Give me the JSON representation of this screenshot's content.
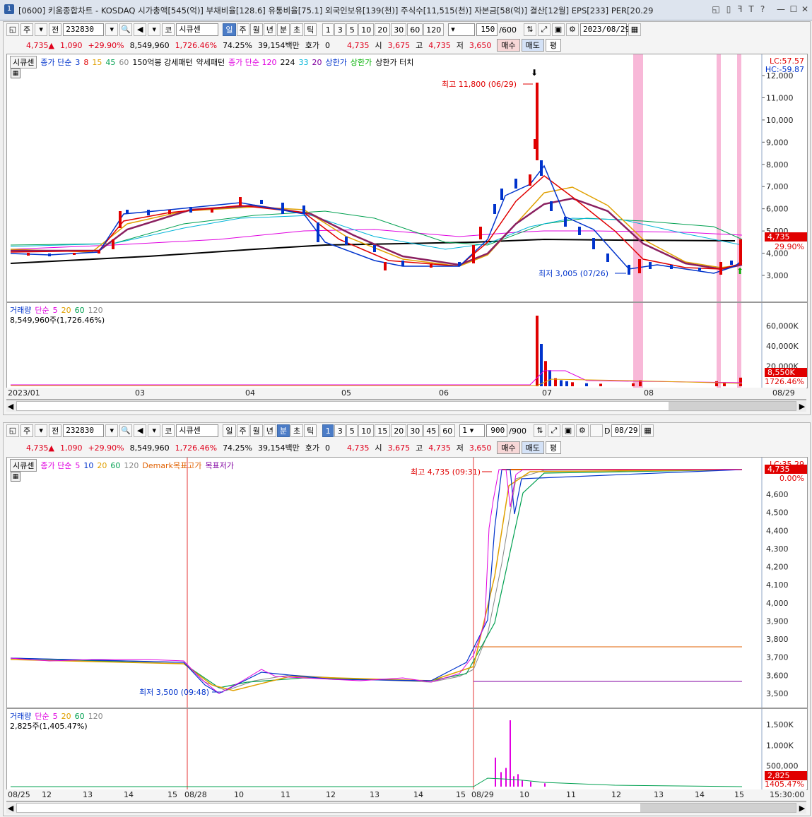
{
  "window": {
    "app_number": "1",
    "title": "[0600] 키움종합차트 - KOSDAQ 시가총액[545(억)] 부채비율[128.6] 유통비율[75.1] 외국인보유[139(천)] 주식수[11,515(천)] 자본금[58(억)] 결산[12월] EPS[233] PER[20.29",
    "controls": [
      "◱",
      "▯",
      "ꟻ",
      "T",
      "?",
      "—",
      "☐",
      "✕"
    ]
  },
  "top": {
    "toolbar": {
      "mode_jusik": "주",
      "mode_jeon": "전",
      "code": "232830",
      "market": "코",
      "name": "시큐센",
      "periods": [
        "일",
        "주",
        "월",
        "년",
        "분",
        "초",
        "틱"
      ],
      "active_period": "일",
      "numbers": [
        "1",
        "3",
        "5",
        "10",
        "20",
        "30",
        "60",
        "120"
      ],
      "count": "150",
      "count_max": "/600",
      "date": "2023/08/29"
    },
    "quote": {
      "price": "4,735",
      "change": "1,090",
      "pct": "+29.90%",
      "volume": "8,549,960",
      "vol_pct": "1,726.46%",
      "turnover": "74.25%",
      "amount": "39,154백만",
      "hoga_label": "호가",
      "hoga": "0",
      "last": "4,735",
      "open_label": "시",
      "open": "3,675",
      "high_label": "고",
      "high": "4,735",
      "low_label": "저",
      "low": "3,650",
      "buy": "매수",
      "sell": "매도",
      "avg": "평"
    },
    "legend": {
      "name": "시큐센",
      "ma_label": "종가 단순",
      "ma": [
        "3",
        "8",
        "15",
        "45",
        "60"
      ],
      "p150": "150억봉 강세패턴",
      "weak": "약세패턴",
      "ma2_label": "종가 단순 120",
      "ma2": [
        "224",
        "33",
        "20"
      ],
      "upper1": "상한가",
      "upper2": "상한가",
      "touch": "상한가 터치"
    },
    "annotations": {
      "high": "최고 11,800 (06/29)",
      "low": "최저 3,005 (07/26)",
      "lc": "LC:57.57",
      "hc": "HC:-59.87",
      "price_tag": "4,735",
      "pct_tag": "29.90%"
    },
    "y_ticks": [
      "12,000",
      "11,000",
      "10,000",
      "9,000",
      "8,000",
      "7,000",
      "6,000",
      "5,000",
      "4,000",
      "3,000"
    ],
    "volume": {
      "label": "거래량",
      "ma_label": "단순",
      "ma": [
        "5",
        "20",
        "60",
        "120"
      ],
      "value": "8,549,960주(1,726.46%)",
      "ticks": [
        "60,000K",
        "40,000K",
        "20,000K"
      ],
      "tag": "8,550K",
      "tag_pct": "1726.46%"
    },
    "x_ticks": [
      "2023/01",
      "03",
      "04",
      "05",
      "06",
      "07",
      "08",
      "08/29"
    ]
  },
  "bottom": {
    "toolbar": {
      "mode_jusik": "주",
      "mode_jeon": "전",
      "code": "232830",
      "market": "코",
      "name": "시큐센",
      "periods": [
        "일",
        "주",
        "월",
        "년",
        "분",
        "초",
        "틱"
      ],
      "active_period": "분",
      "numbers": [
        "1",
        "3",
        "5",
        "10",
        "15",
        "20",
        "30",
        "45",
        "60"
      ],
      "unit": "1",
      "count": "900",
      "count_max": "/900",
      "date_prefix": "D",
      "date": "08/29"
    },
    "quote": {
      "price": "4,735",
      "change": "1,090",
      "pct": "+29.90%",
      "volume": "8,549,960",
      "vol_pct": "1,726.46%",
      "turnover": "74.25%",
      "amount": "39,154백만",
      "hoga_label": "호가",
      "hoga": "0",
      "last": "4,735",
      "open_label": "시",
      "open": "3,675",
      "high_label": "고",
      "high": "4,735",
      "low_label": "저",
      "low": "3,650",
      "buy": "매수",
      "sell": "매도",
      "avg": "평"
    },
    "legend": {
      "name": "시큐센",
      "ma_label": "종가 단순",
      "ma": [
        "5",
        "10",
        "20",
        "60",
        "120"
      ],
      "demark": "Demark목표고가",
      "demark_low": "목표저가"
    },
    "annotations": {
      "high": "최고 4,735 (09:31)",
      "low": "최저 3,500 (09:48)",
      "lc": "LC:35.29",
      "price_tag": "4,735",
      "pct_tag": "0.00%"
    },
    "y_ticks": [
      "4,600",
      "4,500",
      "4,400",
      "4,300",
      "4,200",
      "4,100",
      "4,000",
      "3,900",
      "3,800",
      "3,700",
      "3,600",
      "3,500"
    ],
    "volume": {
      "label": "거래량",
      "ma_label": "단순",
      "ma": [
        "5",
        "20",
        "60",
        "120"
      ],
      "value": "2,825주(1,405.47%)",
      "ticks": [
        "1,500K",
        "1,000K",
        "500,000"
      ],
      "tag": "2,825",
      "tag_pct": "1405.47%"
    },
    "x_ticks": [
      "08/25",
      "12",
      "13",
      "14",
      "15",
      "08/28",
      "10",
      "11",
      "12",
      "13",
      "14",
      "15",
      "08/29",
      "10",
      "11",
      "12",
      "13",
      "14",
      "15",
      "15:30:00"
    ]
  }
}
